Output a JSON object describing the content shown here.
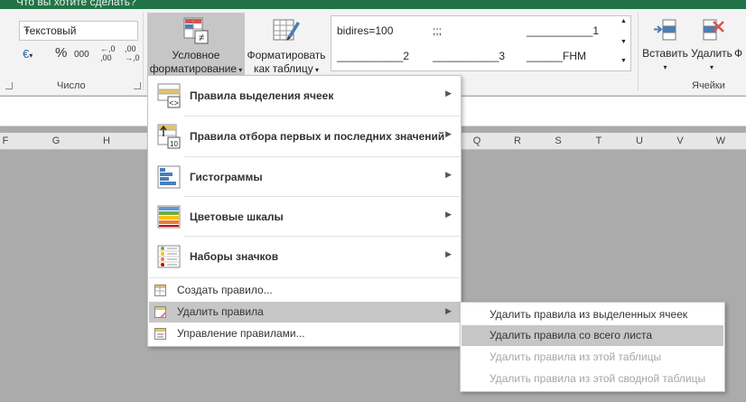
{
  "titlebar": {
    "tell_me": "Что вы хотите сделать?"
  },
  "ribbon": {
    "number": {
      "format_value": "Текстовый",
      "currency_symbol": "€",
      "percent_symbol": "%",
      "comma_symbol": "000",
      "inc_decimal": "←,0\n,00",
      "dec_decimal": ",00\n→,0",
      "label": "Число"
    },
    "styles": {
      "conditional_formatting_line1": "Условное",
      "conditional_formatting_line2": "форматирование",
      "format_as_table_line1": "Форматировать",
      "format_as_table_line2": "как таблицу",
      "gallery": {
        "cell1": "bidires=100",
        "cell2": ";;;",
        "cell3": "___________1",
        "cell4": "___________2",
        "cell5": "___________3",
        "cell6": "______FHM"
      }
    },
    "cells": {
      "insert": "Вставить",
      "delete": "Удалить",
      "format_partial": "Ф",
      "label": "Ячейки"
    }
  },
  "columns": [
    "F",
    "G",
    "H",
    "Q",
    "R",
    "S",
    "T",
    "U",
    "V",
    "W"
  ],
  "menu": {
    "items": [
      {
        "label": "Правила выделения ячеек",
        "icon": "highlight-rules-icon"
      },
      {
        "label": "Правила отбора первых и последних значений",
        "icon": "top-bottom-rules-icon"
      },
      {
        "label": "Гистограммы",
        "icon": "data-bars-icon"
      },
      {
        "label": "Цветовые шкалы",
        "icon": "color-scales-icon"
      },
      {
        "label": "Наборы значков",
        "icon": "icon-sets-icon"
      }
    ],
    "new_rule": "Создать правило...",
    "clear_rules": "Удалить правила",
    "manage_rules": "Управление правилами..."
  },
  "submenu": {
    "items": [
      {
        "label": "Удалить правила из выделенных ячеек",
        "enabled": true
      },
      {
        "label": "Удалить правила со всего листа",
        "enabled": true,
        "highlighted": true
      },
      {
        "label": "Удалить правила из этой таблицы",
        "enabled": false
      },
      {
        "label": "Удалить правила из этой сводной таблицы",
        "enabled": false
      }
    ]
  },
  "colors": {
    "excel_green": "#217346",
    "hover": "#c6c6c6",
    "grid_bg": "#ababab"
  }
}
